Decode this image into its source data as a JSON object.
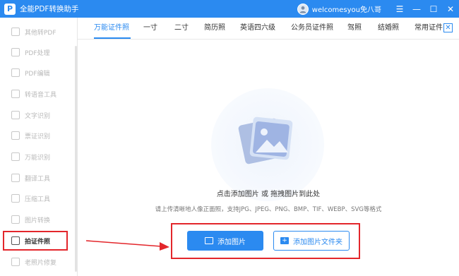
{
  "app": {
    "title": "全能PDF转换助手",
    "logo_glyph": "P"
  },
  "user": {
    "name": "welcomesyou免八哥"
  },
  "window_controls": {
    "menu": "☰",
    "minimize": "—",
    "maximize": "☐",
    "close": "✕"
  },
  "sidebar": {
    "items": [
      {
        "label": "其他转PDF"
      },
      {
        "label": "PDF处理"
      },
      {
        "label": "PDF编辑"
      },
      {
        "label": "转语音工具"
      },
      {
        "label": "文字识别"
      },
      {
        "label": "票证识别"
      },
      {
        "label": "万能识别"
      },
      {
        "label": "翻译工具"
      },
      {
        "label": "压缩工具"
      },
      {
        "label": "图片转换"
      },
      {
        "label": "拍证件照",
        "active": true
      },
      {
        "label": "老照片修复"
      }
    ]
  },
  "tabs": [
    {
      "label": "万能证件照",
      "active": true
    },
    {
      "label": "一寸"
    },
    {
      "label": "二寸"
    },
    {
      "label": "简历照"
    },
    {
      "label": "英语四六级"
    },
    {
      "label": "公务员证件照"
    },
    {
      "label": "驾照"
    },
    {
      "label": "结婚照"
    },
    {
      "label": "常用证件"
    }
  ],
  "tabs_close_glyph": "✕",
  "main": {
    "drop_title": "点击添加图片 或 拖拽图片到此处",
    "drop_hint": "请上传清晰地人像正面照，支持JPG、JPEG、PNG、BMP、TIF、WEBP、SVG等格式",
    "add_image_label": "添加图片",
    "add_folder_label": "添加图片文件夹",
    "folder_icon_glyph": "+"
  },
  "colors": {
    "accent": "#2b8af0",
    "annotation_red": "#e3262b"
  }
}
